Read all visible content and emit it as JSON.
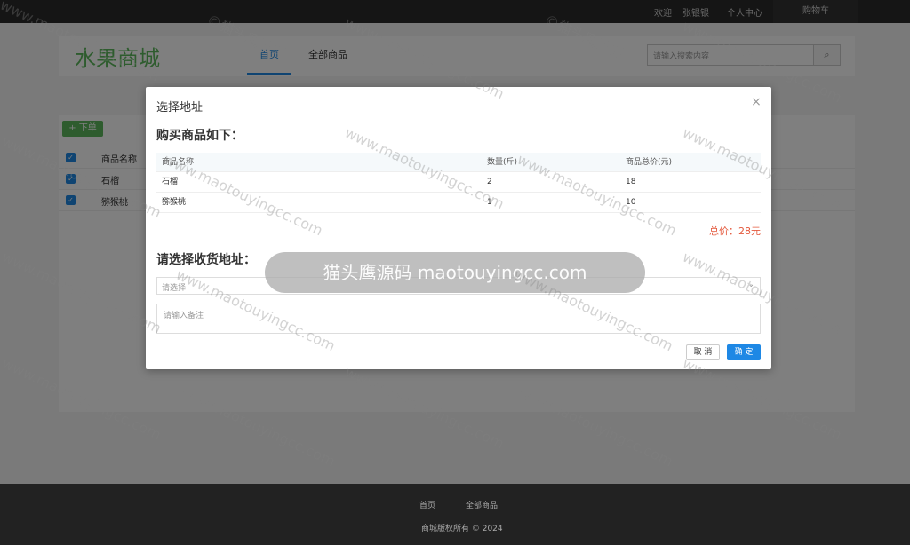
{
  "topbar": {
    "welcome": "欢迎",
    "username": "张银银",
    "personal_center": "个人中心",
    "cart": "购物车"
  },
  "header": {
    "logo": "水果商城",
    "nav": {
      "home": "首页",
      "all_goods": "全部商品"
    },
    "search_placeholder": "请输入搜索内容",
    "search_icon": "search-icon"
  },
  "cart_panel": {
    "order_button": "+ 下单",
    "column_name": "商品名称",
    "rows": [
      {
        "name": "石榴",
        "checked": true
      },
      {
        "name": "猕猴桃",
        "checked": true
      }
    ]
  },
  "modal": {
    "title": "选择地址",
    "goods_heading": "购买商品如下：",
    "columns": [
      "商品名称",
      "数量(斤)",
      "商品总价(元)"
    ],
    "goods": [
      {
        "name": "石榴",
        "qty": "2",
        "total": "18"
      },
      {
        "name": "猕猴桃",
        "qty": "1",
        "total": "10"
      }
    ],
    "total_text": "总价：28元",
    "address_heading": "请选择收货地址：",
    "address_placeholder": "请选择",
    "note_placeholder": "请输入备注",
    "cancel": "取 消",
    "confirm": "确 定"
  },
  "footer": {
    "link_home": "首页",
    "separator": "|",
    "link_all": "全部商品",
    "copyright": "商城版权所有 © 2024"
  },
  "watermark": {
    "banner": "猫头鹰源码 maotouyingcc.com",
    "brand": "©猫头鹰源码",
    "site": "www.maotouyingcc.com"
  },
  "colors": {
    "accent": "#1e88e5",
    "logo_green": "#5cb85c",
    "price_red": "#e4593d"
  }
}
